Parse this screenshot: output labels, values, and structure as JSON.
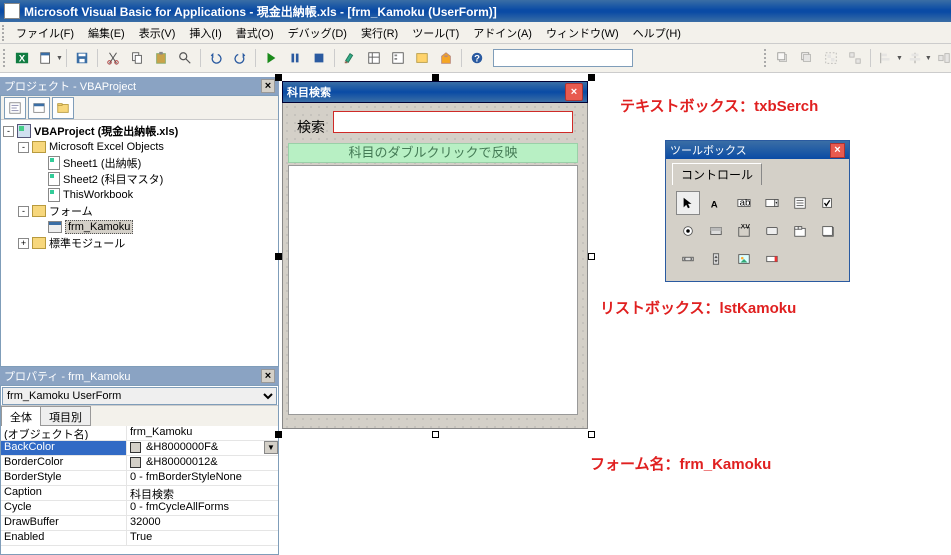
{
  "titlebar": {
    "text": "Microsoft Visual Basic for Applications - 現金出納帳.xls - [frm_Kamoku (UserForm)]"
  },
  "menu": {
    "file": "ファイル(F)",
    "edit": "編集(E)",
    "view": "表示(V)",
    "insert": "挿入(I)",
    "format": "書式(O)",
    "debug": "デバッグ(D)",
    "run": "実行(R)",
    "tools": "ツール(T)",
    "addins": "アドイン(A)",
    "window": "ウィンドウ(W)",
    "help": "ヘルプ(H)"
  },
  "project_pane": {
    "title": "プロジェクト - VBAProject",
    "root": "VBAProject (現金出納帳.xls)",
    "excel_objects": "Microsoft Excel Objects",
    "sheet1": "Sheet1 (出納帳)",
    "sheet2": "Sheet2 (科目マスタ)",
    "thiswb": "ThisWorkbook",
    "forms": "フォーム",
    "frm": "frm_Kamoku",
    "modules": "標準モジュール"
  },
  "properties_pane": {
    "title": "プロパティ - frm_Kamoku",
    "combo": "frm_Kamoku UserForm",
    "tab_all": "全体",
    "tab_cat": "項目別",
    "rows": [
      {
        "k": "(オブジェクト名)",
        "v": "frm_Kamoku"
      },
      {
        "k": "BackColor",
        "v": "&H8000000F&",
        "swatch": true,
        "sel": true,
        "dd": true
      },
      {
        "k": "BorderColor",
        "v": "&H80000012&",
        "swatch": true
      },
      {
        "k": "BorderStyle",
        "v": "0 - fmBorderStyleNone"
      },
      {
        "k": "Caption",
        "v": "科目検索"
      },
      {
        "k": "Cycle",
        "v": "0 - fmCycleAllForms"
      },
      {
        "k": "DrawBuffer",
        "v": "32000"
      },
      {
        "k": "Enabled",
        "v": "True"
      }
    ]
  },
  "userform": {
    "caption": "科目検索",
    "search_label": "検索",
    "banner": "科目のダブルクリックで反映"
  },
  "annotations": {
    "a1": "テキストボックス：txbSerch",
    "a2": "リストボックス：lstKamoku",
    "a3": "フォーム名：frm_Kamoku"
  },
  "toolbox": {
    "title": "ツールボックス",
    "tab": "コントロール"
  }
}
